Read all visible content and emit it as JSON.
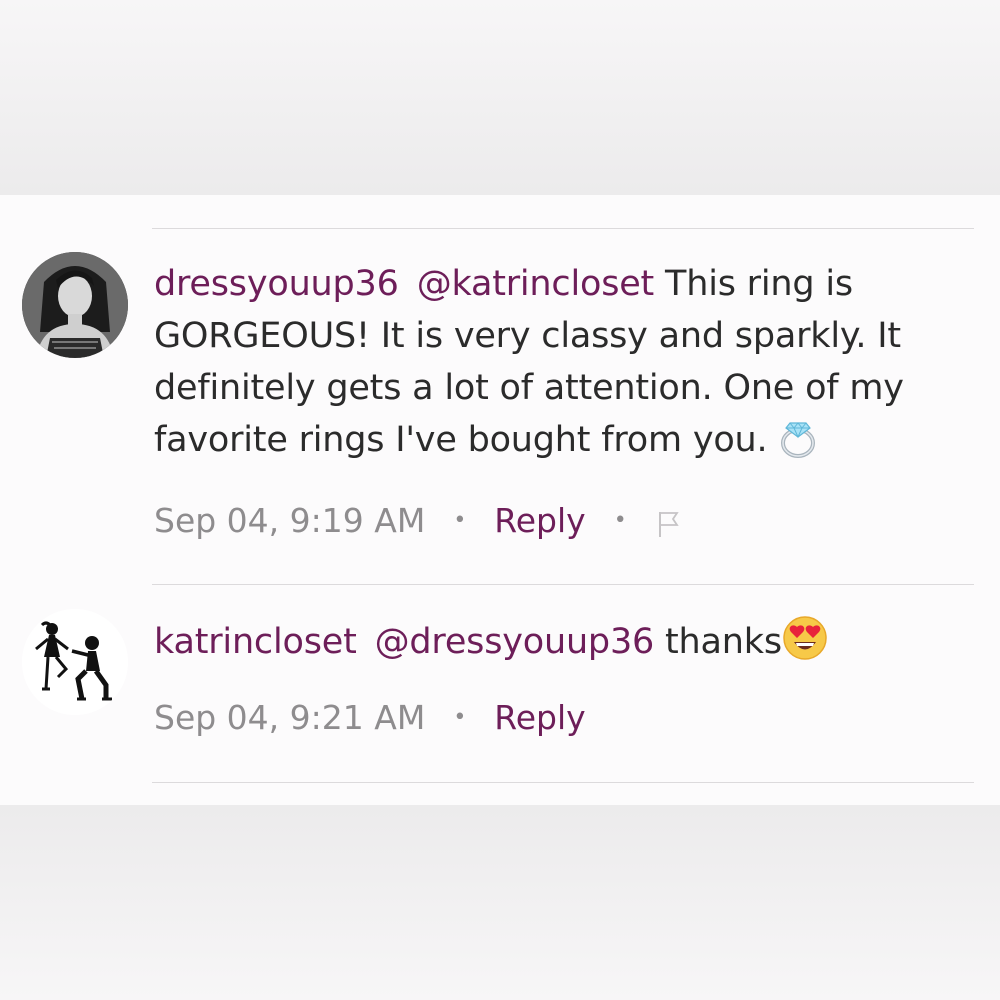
{
  "comments": [
    {
      "username": "dressyouup36",
      "mention": "@katrincloset",
      "text": "This ring is GORGEOUS! It is very classy and sparkly. It definitely gets a lot of attention. One of my favorite rings I've bought from you.",
      "emoji": "ring-emoji",
      "timestamp": "Sep 04, 9:19 AM",
      "separator": "•",
      "reply_label": "Reply",
      "has_flag": true
    },
    {
      "username": "katrincloset",
      "mention": "@dressyouup36",
      "text": "thanks",
      "emoji": "heart-eyes-emoji",
      "timestamp": "Sep 04, 9:21 AM",
      "separator": "•",
      "reply_label": "Reply",
      "has_flag": false
    }
  ],
  "colors": {
    "accent": "#6d1e59",
    "text": "#2b2b2b",
    "meta": "#8e8c8e",
    "divider": "#dcdadc",
    "panel": "#fcfbfc"
  }
}
